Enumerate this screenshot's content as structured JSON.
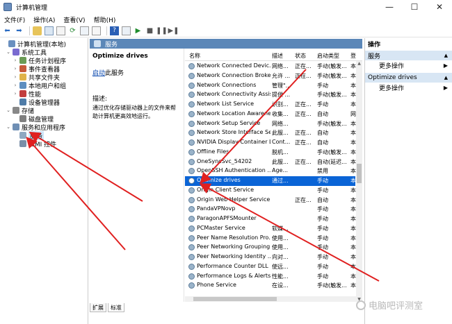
{
  "window": {
    "title": "计算机管理",
    "controls": [
      "—",
      "☐",
      "✕"
    ]
  },
  "menu": [
    "文件(F)",
    "操作(A)",
    "查看(V)",
    "帮助(H)"
  ],
  "tree": [
    {
      "label": "计算机管理(本地)",
      "level": 0,
      "exp": "",
      "color": "#6a8fbf"
    },
    {
      "label": "系统工具",
      "level": 1,
      "exp": "⌄",
      "color": "#7a6bd0"
    },
    {
      "label": "任务计划程序",
      "level": 2,
      "exp": "›",
      "color": "#6b9b55"
    },
    {
      "label": "事件查看器",
      "level": 2,
      "exp": "›",
      "color": "#c75a3a"
    },
    {
      "label": "共享文件夹",
      "level": 2,
      "exp": "›",
      "color": "#e0b34a"
    },
    {
      "label": "本地用户和组",
      "level": 2,
      "exp": "›",
      "color": "#5c8ec0"
    },
    {
      "label": "性能",
      "level": 2,
      "exp": "›",
      "color": "#c23d3d"
    },
    {
      "label": "设备管理器",
      "level": 2,
      "exp": "",
      "color": "#4f7ca8"
    },
    {
      "label": "存储",
      "level": 1,
      "exp": "⌄",
      "color": "#888888"
    },
    {
      "label": "磁盘管理",
      "level": 2,
      "exp": "",
      "color": "#7f7f7f"
    },
    {
      "label": "服务和应用程序",
      "level": 1,
      "exp": "⌄",
      "color": "#6f8fb4"
    },
    {
      "label": "服务",
      "level": 2,
      "exp": "",
      "color": "#8fa8c1",
      "selected": true
    },
    {
      "label": "WMI 控件",
      "level": 2,
      "exp": "",
      "color": "#7a8fa8"
    }
  ],
  "services_header": "服务",
  "details": {
    "title": "Optimize drives",
    "start_link": "启动",
    "start_suffix": "此服务",
    "desc_label": "描述:",
    "desc_text": "通过优化存储驱动器上的文件来帮助计算机更高效地运行。"
  },
  "columns": [
    "名称",
    "描述",
    "状态",
    "启动类型",
    "登"
  ],
  "rows": [
    [
      "Network Connected Devic...",
      "网络...",
      "正在...",
      "手动(触发...",
      "本"
    ],
    [
      "Network Connection Broker",
      "允许 ...",
      "正在...",
      "手动(触发...",
      "本"
    ],
    [
      "Network Connections",
      "管理\"...",
      "",
      "手动",
      "本"
    ],
    [
      "Network Connectivity Assis...",
      "提供 ...",
      "",
      "手动(触发...",
      "本"
    ],
    [
      "Network List Service",
      "识别...",
      "正在...",
      "手动",
      "本"
    ],
    [
      "Network Location Awarene...",
      "收集...",
      "正在...",
      "自动",
      "网"
    ],
    [
      "Network Setup Service",
      "网络...",
      "",
      "手动(触发...",
      "本"
    ],
    [
      "Network Store Interface Se...",
      "此服...",
      "正在...",
      "自动",
      "本"
    ],
    [
      "NVIDIA Display Container LS",
      "Cont...",
      "正在...",
      "自动",
      "本"
    ],
    [
      "Offline Files",
      "脱机...",
      "",
      "手动(触发...",
      "本"
    ],
    [
      "OneSyncSvc_54202",
      "此服...",
      "正在...",
      "自动(延迟...",
      "本"
    ],
    [
      "OpenSSH Authentication ...",
      "Age...",
      "",
      "禁用",
      "本"
    ],
    [
      "Optimize drives",
      "通过...",
      "",
      "手动",
      "本"
    ],
    [
      "Origin Client Service",
      "",
      "",
      "手动",
      "本"
    ],
    [
      "Origin Web Helper Service",
      "",
      "正在...",
      "自动",
      "本"
    ],
    [
      "PandaVPNovp",
      "",
      "",
      "手动",
      "本"
    ],
    [
      "ParagonAPFSMounter",
      "",
      "",
      "手动",
      "本"
    ],
    [
      "PCMaster Service",
      "软媒...",
      "",
      "手动",
      "本"
    ],
    [
      "Peer Name Resolution Pro...",
      "使用...",
      "",
      "手动",
      "本"
    ],
    [
      "Peer Networking Grouping",
      "使用...",
      "",
      "手动",
      "本"
    ],
    [
      "Peer Networking Identity ...",
      "向对...",
      "",
      "手动",
      "本"
    ],
    [
      "Performance Counter DLL ...",
      "使远...",
      "",
      "手动",
      "本"
    ],
    [
      "Performance Logs & Alerts",
      "性能...",
      "",
      "手动",
      "本"
    ],
    [
      "Phone Service",
      "在设...",
      "",
      "手动(触发...",
      "本"
    ]
  ],
  "selected_row": 12,
  "tabs": [
    "扩展",
    "标准"
  ],
  "actions": {
    "title": "操作",
    "sections": [
      {
        "label": "服务",
        "item": "更多操作"
      },
      {
        "label": "Optimize drives",
        "item": "更多操作"
      }
    ]
  },
  "watermark": "电脑吧评测室",
  "colors": {
    "header_blue": "#5b87b8",
    "selection": "#0a64d6",
    "annotation": "#e02020"
  }
}
